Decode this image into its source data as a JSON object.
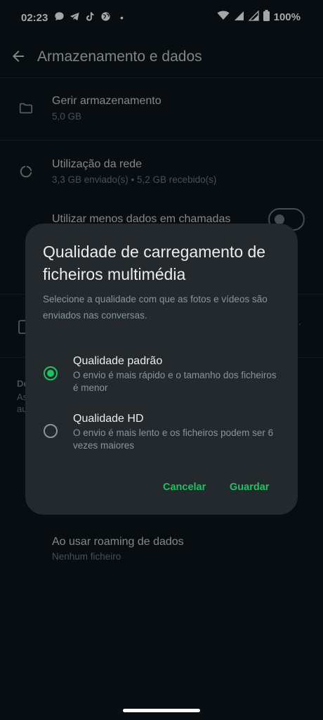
{
  "status_bar": {
    "time": "02:23",
    "battery": "100%",
    "left_icons": [
      "chat-bubble-icon",
      "telegram-icon",
      "tiktok-icon",
      "globe-icon"
    ],
    "dot": "•"
  },
  "header": {
    "title": "Armazenamento e dados"
  },
  "settings": {
    "manage_storage": {
      "title": "Gerir armazenamento",
      "subtitle": "5,0 GB"
    },
    "network_usage": {
      "title": "Utilização da rede",
      "subtitle": "3,3 GB enviado(s) • 5,2 GB recebido(s)"
    },
    "less_data_calls": {
      "title": "Utilizar menos dados em chamadas",
      "enabled": false
    },
    "roaming": {
      "title": "Ao usar roaming de dados",
      "subtitle": "Nenhum ficheiro"
    }
  },
  "peek": {
    "left_top": "Do",
    "left_mid": "As",
    "left_bot": "au",
    "right_ellipsis": "..."
  },
  "dialog": {
    "title": "Qualidade de carregamento de ficheiros multimédia",
    "description": "Selecione a qualidade com que as fotos e vídeos são enviados nas conversas.",
    "options": [
      {
        "title": "Qualidade padrão",
        "description": "O envio é mais rápido e o tamanho dos ficheiros é menor",
        "selected": true
      },
      {
        "title": "Qualidade HD",
        "description": "O envio é mais lento e os ficheiros podem ser 6 vezes maiores",
        "selected": false
      }
    ],
    "cancel_label": "Cancelar",
    "save_label": "Guardar"
  },
  "colors": {
    "accent": "#21c063",
    "background": "#0b141a",
    "dialog": "#23292d"
  }
}
